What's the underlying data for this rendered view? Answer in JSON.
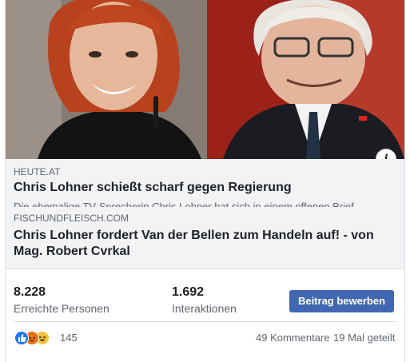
{
  "colors": {
    "accent": "#4267b2",
    "link_bg": "#f2f3f5",
    "muted": "#606770"
  },
  "preview_image": {
    "alt": "Two portraits side by side"
  },
  "info_icon": "i",
  "link1": {
    "domain": "HEUTE.AT",
    "title": "Chris Lohner schießt scharf gegen Regierung",
    "description": "Die ehemalige TV-Sprecherin Chris Lohner hat sich in einem offenen Brief"
  },
  "link2": {
    "domain": "FISCHUNDFLEISCH.COM",
    "title_line1": "Chris Lohner fordert Van der Bellen zum Handeln auf! - von",
    "title_line2": "Mag. Robert Cvrkal"
  },
  "stats": {
    "reach_value": "8.228",
    "reach_label": "Erreichte Personen",
    "engagement_value": "1.692",
    "engagement_label": "Interaktionen",
    "boost_label": "Beitrag bewerben"
  },
  "reactions": {
    "icons": [
      "like-icon",
      "angry-icon",
      "haha-icon"
    ],
    "count": "145"
  },
  "comments": "49 Kommentare",
  "shares": "19 Mal geteilt"
}
